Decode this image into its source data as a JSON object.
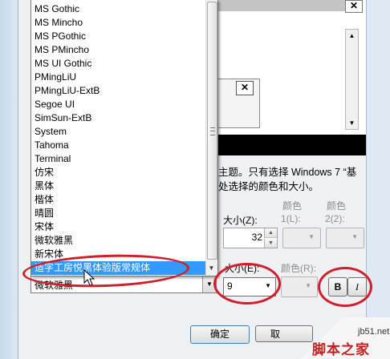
{
  "font_list": {
    "items": [
      "MS Gothic",
      "MS Mincho",
      "MS PGothic",
      "MS PMincho",
      "MS UI Gothic",
      "PMingLiU",
      "PMingLiU-ExtB",
      "Segoe UI",
      "SimSun-ExtB",
      "System",
      "Tahoma",
      "Terminal",
      "仿宋",
      "黑体",
      "楷体",
      "晴圆",
      "宋体",
      "微软雅黑",
      "新宋体",
      "造字工房悦黑体验版常规体"
    ],
    "selected": "造字工房悦黑体验版常规体"
  },
  "font_combo": {
    "value": "微软雅黑"
  },
  "preview": {
    "close_glyph": "✕",
    "msg_close_glyph": "✕"
  },
  "description": {
    "line1": "主题。只有选择 Windows 7 “基",
    "line2": "处选择的颜色和大小。"
  },
  "item_size": {
    "label": "大小(Z):",
    "value": "32"
  },
  "color1": {
    "label_top": "颜色",
    "label": "1(L):"
  },
  "color2": {
    "label_top": "颜色",
    "label": "2(2):"
  },
  "font_size": {
    "label": "大小(E):",
    "value": "9"
  },
  "font_color": {
    "label": "颜色(R):"
  },
  "bold": {
    "label": "B"
  },
  "italic": {
    "label": "I"
  },
  "buttons": {
    "ok": "确定",
    "cancel": "取"
  },
  "watermark": {
    "site": "jb51.net",
    "name": "脚本之家"
  },
  "annotation_color": "#d01e2a"
}
